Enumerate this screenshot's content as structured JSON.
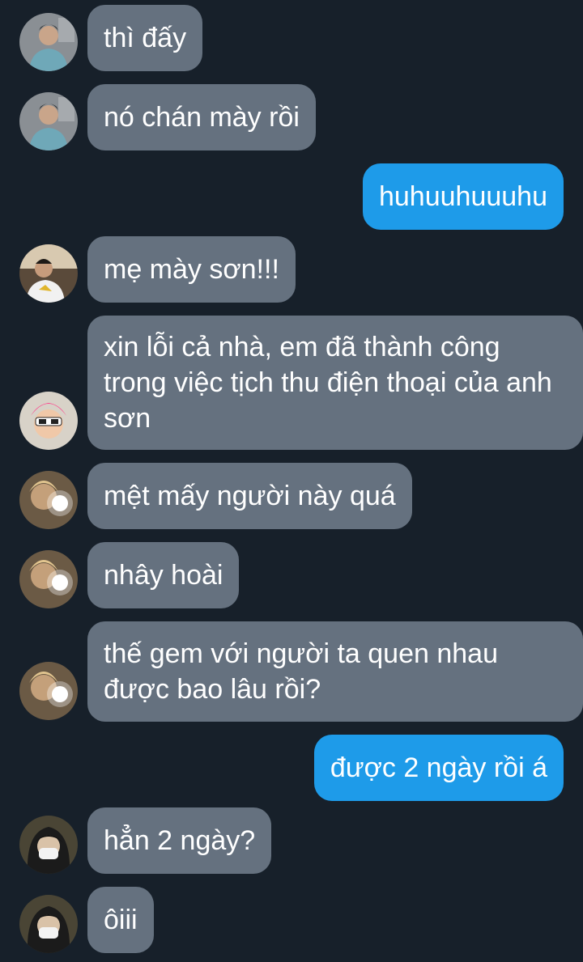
{
  "colors": {
    "background": "#17202a",
    "incoming_bubble": "#65717f",
    "outgoing_bubble": "#1e9be9",
    "text": "#ffffff"
  },
  "messages": [
    {
      "direction": "incoming",
      "sender_avatar": "avatar-user-a",
      "text": "thì đấy"
    },
    {
      "direction": "incoming",
      "sender_avatar": "avatar-user-a",
      "text": "nó chán mày rồi"
    },
    {
      "direction": "outgoing",
      "text": "huhuuhuuuhu"
    },
    {
      "direction": "incoming",
      "sender_avatar": "avatar-user-b",
      "text": "mẹ mày sơn!!!"
    },
    {
      "direction": "incoming",
      "sender_avatar": "avatar-user-c",
      "text": "xin lỗi cả nhà, em đã thành công trong việc tịch thu điện thoại của anh sơn"
    },
    {
      "direction": "incoming",
      "sender_avatar": "avatar-user-d",
      "text": "mệt mấy người này quá"
    },
    {
      "direction": "incoming",
      "sender_avatar": "avatar-user-d",
      "text": "nhây hoài"
    },
    {
      "direction": "incoming",
      "sender_avatar": "avatar-user-d",
      "text": "thế gem với người ta quen nhau được bao lâu rồi?"
    },
    {
      "direction": "outgoing",
      "text": "được 2 ngày rồi á"
    },
    {
      "direction": "incoming",
      "sender_avatar": "avatar-user-e",
      "text": "hẳn 2 ngày?"
    },
    {
      "direction": "incoming",
      "sender_avatar": "avatar-user-e",
      "text": "ôiii"
    }
  ]
}
